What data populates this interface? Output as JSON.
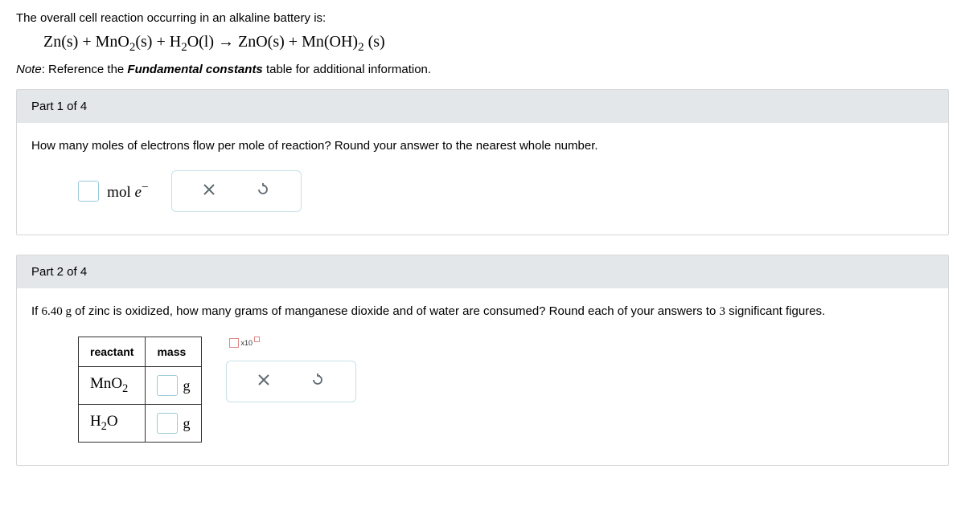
{
  "intro": "The overall cell reaction occurring in an alkaline battery is:",
  "equation": {
    "lhs1": "Zn(s)",
    "plus": " + ",
    "lhs2_a": "MnO",
    "lhs2_sub": "2",
    "lhs2_b": "(s)",
    "lhs3_a": "H",
    "lhs3_sub": "2",
    "lhs3_b": "O(l)",
    "arrow": "  →  ",
    "rhs1": "ZnO(s)",
    "rhs2_a": "Mn(OH)",
    "rhs2_sub": "2",
    "rhs2_b": " (s)"
  },
  "note_prefix": "Note",
  "note_mid": ": Reference the ",
  "note_link": "Fundamental constants",
  "note_suffix": " table for additional information.",
  "part1": {
    "header": "Part 1 of 4",
    "question": "How many moles of electrons flow per mole of reaction? Round your answer to the nearest whole number.",
    "unit_a": "mol ",
    "unit_b": "e",
    "unit_sup": "−"
  },
  "part2": {
    "header": "Part 2 of 4",
    "q_a": "If ",
    "q_val": "6.40 g",
    "q_b": " of zinc is oxidized, how many grams of manganese dioxide and of water are consumed? Round each of your answers to ",
    "q_sig": "3",
    "q_c": " significant figures.",
    "col_reactant": "reactant",
    "col_mass": "mass",
    "row1_a": "MnO",
    "row1_sub": "2",
    "row2_a": "H",
    "row2_sub": "2",
    "row2_b": "O",
    "unit": "g",
    "sci_x10": "x10"
  }
}
